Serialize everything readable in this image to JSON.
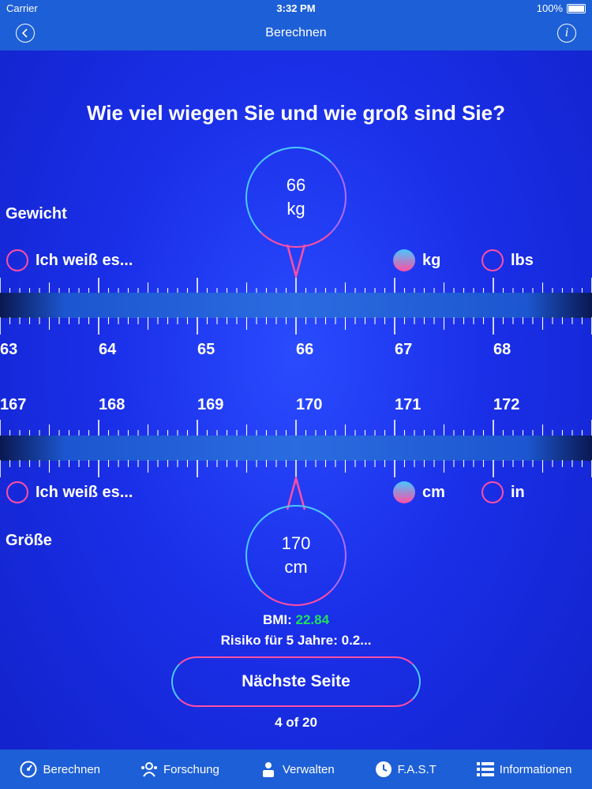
{
  "status": {
    "carrier": "Carrier",
    "time": "3:32 PM",
    "battery": "100%"
  },
  "nav": {
    "title": "Berechnen",
    "back_icon": "chevron-left-icon",
    "info_icon": "info-icon",
    "info_glyph": "i"
  },
  "question": "Wie viel wiegen Sie und wie groß sind Sie?",
  "weight": {
    "label": "Gewicht",
    "bubble_value": "66",
    "bubble_unit": "kg",
    "unknown_label": "Ich weiß es...",
    "units": [
      {
        "label": "kg",
        "selected": true
      },
      {
        "label": "lbs",
        "selected": false
      }
    ],
    "ticks": [
      "63",
      "64",
      "65",
      "66",
      "67",
      "68"
    ]
  },
  "height": {
    "label": "Größe",
    "bubble_value": "170",
    "bubble_unit": "cm",
    "unknown_label": "Ich weiß es...",
    "units": [
      {
        "label": "cm",
        "selected": true
      },
      {
        "label": "in",
        "selected": false
      }
    ],
    "ticks": [
      "167",
      "168",
      "169",
      "170",
      "171",
      "172"
    ]
  },
  "bmi": {
    "label": "BMI:",
    "value": "22.84",
    "value_color": "#22e05a"
  },
  "risk": "Risiko für 5 Jahre: 0.2...",
  "next_button": "Nächste Seite",
  "pager": "4 of 20",
  "tabs": [
    {
      "label": "Berechnen",
      "icon": "gauge-icon"
    },
    {
      "label": "Forschung",
      "icon": "research-icon"
    },
    {
      "label": "Verwalten",
      "icon": "manager-icon"
    },
    {
      "label": "F.A.S.T",
      "icon": "clock-icon"
    },
    {
      "label": "Informationen",
      "icon": "list-icon"
    }
  ],
  "colors": {
    "bar": "#1d5fd6",
    "accent_pink": "#ff4fa3",
    "accent_cyan": "#4dc7ff"
  }
}
